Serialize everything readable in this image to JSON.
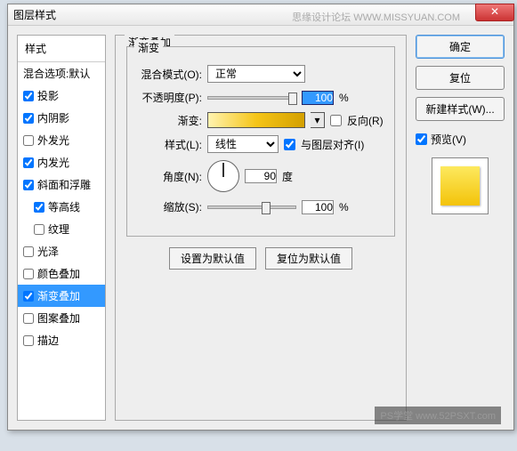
{
  "window": {
    "title": "图层样式",
    "watermark_top": "思缘设计论坛  WWW.MISSYUAN.COM",
    "watermark_bottom": "PS学堂  www.52PSXT.com"
  },
  "sidebar": {
    "header": "样式",
    "blend_options": "混合选项:默认",
    "items": [
      {
        "label": "投影",
        "checked": true,
        "indent": false
      },
      {
        "label": "内阴影",
        "checked": true,
        "indent": false
      },
      {
        "label": "外发光",
        "checked": false,
        "indent": false
      },
      {
        "label": "内发光",
        "checked": true,
        "indent": false
      },
      {
        "label": "斜面和浮雕",
        "checked": true,
        "indent": false
      },
      {
        "label": "等高线",
        "checked": true,
        "indent": true
      },
      {
        "label": "纹理",
        "checked": false,
        "indent": true
      },
      {
        "label": "光泽",
        "checked": false,
        "indent": false
      },
      {
        "label": "颜色叠加",
        "checked": false,
        "indent": false
      },
      {
        "label": "渐变叠加",
        "checked": true,
        "indent": false,
        "selected": true
      },
      {
        "label": "图案叠加",
        "checked": false,
        "indent": false
      },
      {
        "label": "描边",
        "checked": false,
        "indent": false
      }
    ]
  },
  "panel": {
    "title": "渐变叠加",
    "group_title": "渐变",
    "blend_mode_label": "混合模式(O):",
    "blend_mode_value": "正常",
    "opacity_label": "不透明度(P):",
    "opacity_value": "100",
    "opacity_unit": "%",
    "gradient_label": "渐变:",
    "reverse_label": "反向(R)",
    "style_label": "样式(L):",
    "style_value": "线性",
    "align_label": "与图层对齐(I)",
    "angle_label": "角度(N):",
    "angle_value": "90",
    "angle_unit": "度",
    "scale_label": "缩放(S):",
    "scale_value": "100",
    "scale_unit": "%",
    "btn_default": "设置为默认值",
    "btn_reset": "复位为默认值"
  },
  "right": {
    "ok": "确定",
    "cancel": "复位",
    "new_style": "新建样式(W)...",
    "preview_label": "预览(V)"
  }
}
